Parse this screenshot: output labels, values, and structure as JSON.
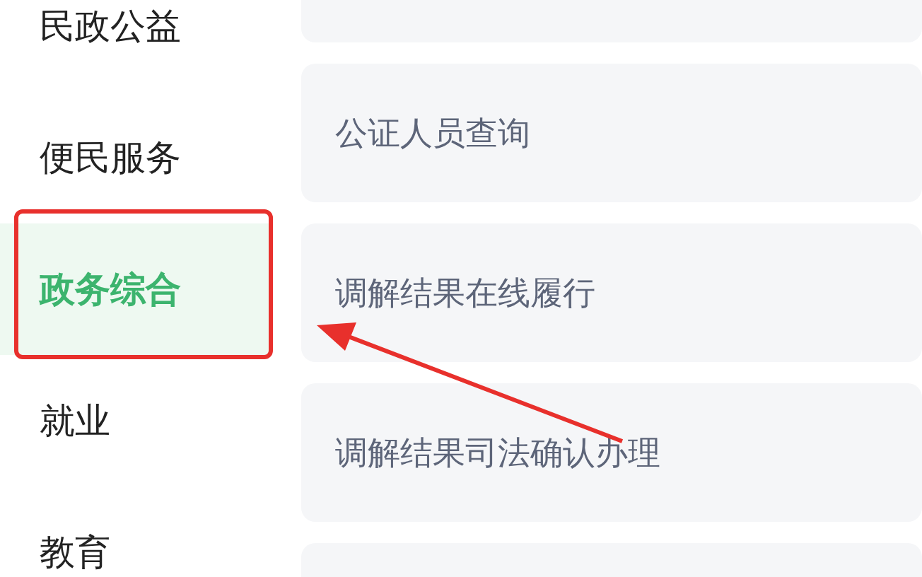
{
  "sidebar": {
    "items": [
      {
        "label": "民政公益",
        "selected": false
      },
      {
        "label": "便民服务",
        "selected": false
      },
      {
        "label": "政务综合",
        "selected": true
      },
      {
        "label": "就业",
        "selected": false
      },
      {
        "label": "教育",
        "selected": false
      }
    ]
  },
  "services": [
    {
      "label": "公证人员查询"
    },
    {
      "label": "调解结果在线履行"
    },
    {
      "label": "调解结果司法确认办理"
    }
  ]
}
